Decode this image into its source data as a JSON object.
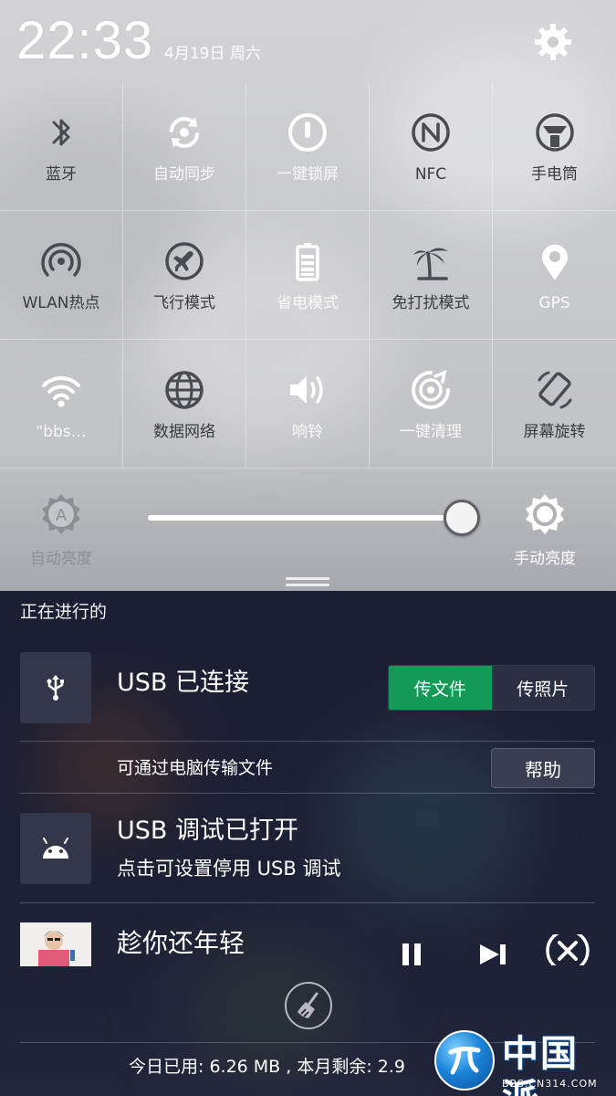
{
  "status": {
    "time": "22:33",
    "date": "4月19日 周六"
  },
  "tiles": [
    {
      "label": "蓝牙",
      "icon": "bluetooth-icon",
      "on": true
    },
    {
      "label": "自动同步",
      "icon": "sync-icon",
      "on": false
    },
    {
      "label": "一键锁屏",
      "icon": "lock-screen-icon",
      "on": false
    },
    {
      "label": "NFC",
      "icon": "nfc-icon",
      "on": true
    },
    {
      "label": "手电筒",
      "icon": "flashlight-icon",
      "on": true
    },
    {
      "label": "WLAN热点",
      "icon": "hotspot-icon",
      "on": true
    },
    {
      "label": "飞行模式",
      "icon": "airplane-icon",
      "on": true
    },
    {
      "label": "省电模式",
      "icon": "battery-saver-icon",
      "on": false
    },
    {
      "label": "免打扰模式",
      "icon": "do-not-disturb-icon",
      "on": true
    },
    {
      "label": "GPS",
      "icon": "gps-icon",
      "on": false
    },
    {
      "label": "\"bbs…",
      "icon": "wifi-icon",
      "on": false
    },
    {
      "label": "数据网络",
      "icon": "mobile-data-icon",
      "on": true
    },
    {
      "label": "响铃",
      "icon": "ringer-icon",
      "on": false
    },
    {
      "label": "一键清理",
      "icon": "clean-icon",
      "on": false
    },
    {
      "label": "屏幕旋转",
      "icon": "rotate-screen-icon",
      "on": true
    }
  ],
  "brightness": {
    "auto_label": "自动亮度",
    "manual_label": "手动亮度",
    "level": 1.0
  },
  "notifications": {
    "section_title": "正在进行的",
    "usb": {
      "title": "USB 已连接",
      "transfer_files": "传文件",
      "transfer_photos": "传照片",
      "description": "可通过电脑传输文件",
      "help": "帮助"
    },
    "debug": {
      "title": "USB 调试已打开",
      "subtitle": "点击可设置停用 USB 调试"
    },
    "music": {
      "title": "趁你还年轻"
    },
    "data_usage": "今日已用: 6.26 MB , 本月剩余: 2.9"
  },
  "watermark": {
    "logo_text": "中国派",
    "url": "BBS.CN314.COM"
  },
  "colors": {
    "accent_green": "#139a57",
    "tile_on_text": "#3a3b3f",
    "tile_off_text": "#fafafa",
    "dark_bg": "#1c1e33"
  }
}
